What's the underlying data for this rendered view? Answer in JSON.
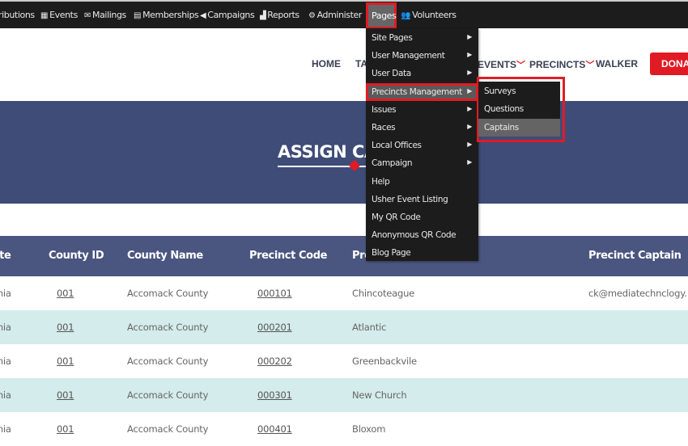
{
  "topbar": {
    "items": [
      {
        "label": "ributions",
        "icon": ""
      },
      {
        "label": "Events",
        "icon": "calendar-icon"
      },
      {
        "label": "Mailings",
        "icon": "envelope-icon"
      },
      {
        "label": "Memberships",
        "icon": "id-card-icon"
      },
      {
        "label": "Campaigns",
        "icon": "megaphone-icon"
      },
      {
        "label": "Reports",
        "icon": "chart-icon"
      },
      {
        "label": "Administer",
        "icon": "gears-icon"
      },
      {
        "label": "Pages",
        "icon": ""
      },
      {
        "label": "Volunteers",
        "icon": "users-icon"
      }
    ]
  },
  "nav": {
    "home": "HOME",
    "ta": "TA",
    "events": "EVENTS",
    "precincts": "PRECINCTS",
    "walker": "WALKER",
    "donate": "DONAT"
  },
  "banner": {
    "title": "ASSIGN CA"
  },
  "menu": {
    "items": [
      "Site Pages",
      "User Management",
      "User Data",
      "Precincts Management",
      "Issues",
      "Races",
      "Local Offices",
      "Campaign",
      "Help",
      "Usher Event Listing",
      "My QR Code",
      "Anonymous QR Code",
      "Blog Page"
    ]
  },
  "submenu": {
    "items": [
      "Surveys",
      "Questions",
      "Captains"
    ]
  },
  "table": {
    "headers": [
      "State",
      "County ID",
      "County Name",
      "Precinct Code",
      "Precinct Name",
      "Precinct Captain"
    ],
    "rows": [
      [
        "Virginia",
        "001",
        "Accomack County",
        "000101",
        "Chincoteague",
        "ck@mediatechnclogy."
      ],
      [
        "Virginia",
        "001",
        "Accomack County",
        "000201",
        "Atlantic",
        ""
      ],
      [
        "Virginia",
        "001",
        "Accomack County",
        "000202",
        "Greenbackvile",
        ""
      ],
      [
        "Virginia",
        "001",
        "Accomack County",
        "000301",
        "New Church",
        ""
      ],
      [
        "Virginia",
        "001",
        "Accomack County",
        "000401",
        "Bloxom",
        ""
      ]
    ]
  },
  "colors": {
    "topbar": "#1c1c1c",
    "banner": "#3f4c78",
    "table_header": "#4a5680",
    "alt_row": "#d4eceb",
    "accent": "#e01b24"
  }
}
